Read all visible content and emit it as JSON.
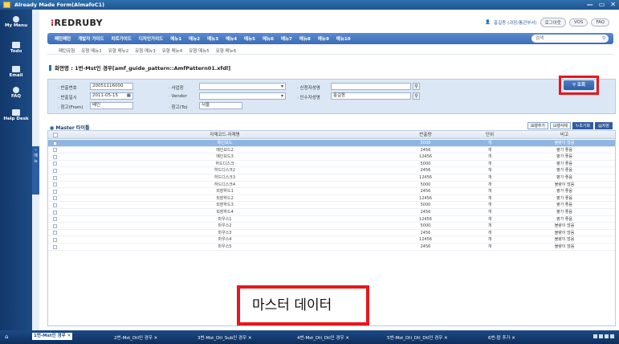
{
  "window": {
    "title": "Already Made Form(AlmafoC1)",
    "controls": [
      "—",
      "▭",
      "✕"
    ]
  },
  "leftbar": [
    {
      "label": "My Menu",
      "icon": "person-icon"
    },
    {
      "label": "Todo",
      "icon": "todo-icon"
    },
    {
      "label": "Email",
      "icon": "mail-icon"
    },
    {
      "label": "FAQ",
      "icon": "faq-icon"
    },
    {
      "label": "Help Desk",
      "icon": "helpdesk-icon"
    }
  ],
  "side_tab": "메뉴",
  "brand": {
    "mark": "⁝",
    "name": "REDRUBY"
  },
  "user": {
    "name": "홍길동 (과장/통관부서)",
    "logout": "로그아웃",
    "vos": "VOS",
    "faq": "FAQ"
  },
  "menubar": {
    "items": [
      "패턴패턴",
      "개발자 가이드",
      "차트가이드",
      "디자인가이드",
      "메뉴1",
      "메뉴2",
      "메뉴3",
      "메뉴4",
      "메뉴5",
      "메뉴6",
      "메뉴7",
      "메뉴8",
      "메뉴9",
      "메뉴10"
    ],
    "search_placeholder": "검색"
  },
  "submenu": [
    "패턴유형",
    "유형 메뉴1",
    "유형 메뉴2",
    "유형 메뉴3",
    "유형 메뉴4",
    "유형 메뉴5",
    "유형 메뉴6"
  ],
  "screen_title": "화면명 : 1번-Mst인 경우[amf_guide_pattern::AmfPattern01.xfdl]",
  "form": {
    "ban_no_label": "· 반출번호",
    "ban_no_value": "20051116000",
    "ban_date_label": "· 반출일시",
    "ban_date_value": "2011-05-15",
    "ref_from_label": "· 참고(From)",
    "ref_from_value": "배인",
    "site_label": "· 사업장",
    "site_value": "",
    "vendor_label": "· Vendor",
    "vendor_value": "",
    "ref_to_label": "· 참고(To)",
    "ref_to_value": "서울",
    "applicant_label": "· 신청자성명",
    "applicant_value": "",
    "receiver_label": "· 인수자성명",
    "receiver_value": "홍길동",
    "query_button": "조회"
  },
  "grid": {
    "title": "Master 타이틀",
    "buttons": [
      "행추가",
      "행삭제",
      "초기화",
      "저장"
    ],
    "columns": [
      "자재코드-자재명",
      "반출량",
      "단위",
      "비고"
    ],
    "rows": [
      [
        "메인보드",
        "5000",
        "개",
        "불량이 많음"
      ],
      [
        "메인보드2",
        "2456",
        "개",
        "평가 좋음"
      ],
      [
        "메인보드3",
        "12456",
        "개",
        "평가 좋음"
      ],
      [
        "하드디스크",
        "5000",
        "개",
        "평가 좋음"
      ],
      [
        "하드디스크2",
        "2456",
        "개",
        "평가 좋음"
      ],
      [
        "하드디스크3",
        "12456",
        "개",
        "평가 좋음"
      ],
      [
        "하드디스크4",
        "5000",
        "개",
        "불량이 많음"
      ],
      [
        "외장하드1",
        "2456",
        "개",
        "평가 좋음"
      ],
      [
        "외장하드2",
        "12456",
        "개",
        "평가 좋음"
      ],
      [
        "외장하드3",
        "5000",
        "개",
        "평가 좋음"
      ],
      [
        "외장하드4",
        "2456",
        "개",
        "평가 좋음"
      ],
      [
        "마우스1",
        "12456",
        "개",
        "평가 좋음"
      ],
      [
        "마우스2",
        "5000",
        "개",
        "불량이 많음"
      ],
      [
        "마우스3",
        "2456",
        "개",
        "불량이 많음"
      ],
      [
        "마우스4",
        "12456",
        "개",
        "불량이 많음"
      ],
      [
        "마우스5",
        "2456",
        "개",
        "불량이 많음"
      ]
    ]
  },
  "overlay_text": "마스터 데이터",
  "taskbar": {
    "tabs": [
      "1번-Mst인 경우",
      "2번-Mst_Dtl인 경우",
      "3번-Mst_Dtl_Sub인 경우",
      "4번-Mst_Dtl_Dtl인 경우",
      "5번-Mst_Dtl_Dtl_Dtl인 경우",
      "6번-팝 추가"
    ]
  }
}
